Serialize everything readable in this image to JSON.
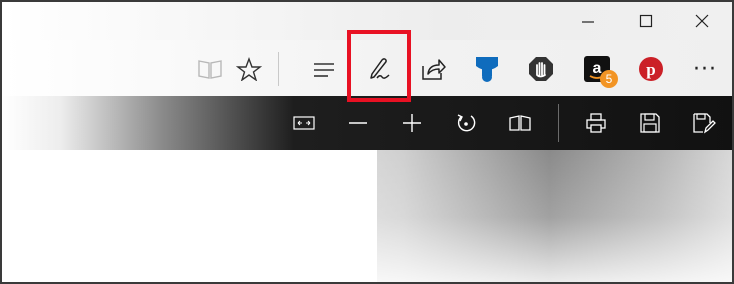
{
  "window": {
    "controls": [
      {
        "name": "minimize",
        "glyph": "—"
      },
      {
        "name": "maximize",
        "glyph": "☐"
      },
      {
        "name": "close",
        "glyph": "✕"
      }
    ]
  },
  "toolbar": {
    "icons": [
      "reading-view-icon",
      "favorite-star-icon",
      "hub-icon",
      "web-note-pen-icon",
      "share-icon",
      "extension-ribbon-icon",
      "adblock-hand-icon",
      "amazon-icon",
      "pinterest-icon",
      "more-icon"
    ],
    "amazon_badge": "5",
    "more_glyph": "···",
    "highlight_color": "#e81123"
  },
  "pdf_toolbar": {
    "icons": [
      "fit-width-icon",
      "zoom-out-icon",
      "zoom-in-icon",
      "rotate-icon",
      "page-layout-icon",
      "print-icon",
      "save-icon",
      "save-as-icon"
    ]
  },
  "colors": {
    "pinterest": "#cb2027",
    "extension_blue": "#0f6cbd",
    "amazon_badge": "#f29424"
  }
}
